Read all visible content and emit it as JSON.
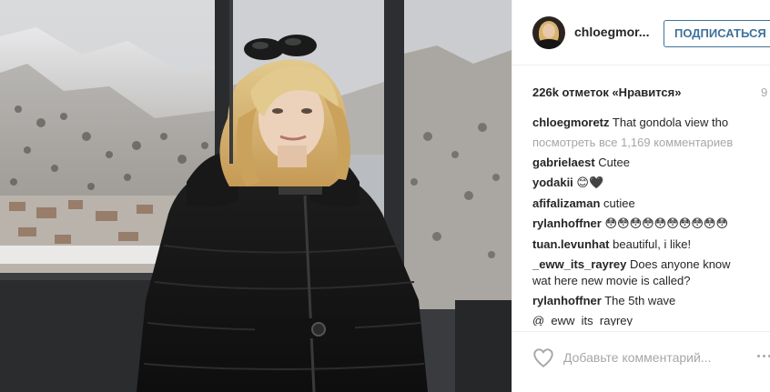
{
  "post": {
    "image_alt": "Photo in gondola with snowy mountains",
    "username": "chloegmor...",
    "follow_label": "ПОДПИСАТЬСЯ",
    "likes": "226k отметок «Нравится»",
    "age": "9",
    "comments": [
      {
        "author": "chloegmoretz",
        "text": "That gondola view tho"
      },
      {
        "author": "",
        "text": "посмотреть все 1,169 комментариев",
        "view_all": true
      },
      {
        "author": "gabrielaest",
        "text": "Cutee"
      },
      {
        "author": "yodakii",
        "text": "😊🖤"
      },
      {
        "author": "afifalizaman",
        "text": "cutiee"
      },
      {
        "author": "rylanhoffner",
        "text": "😳😳😳😳😳😳😳😳😳😳"
      },
      {
        "author": "tuan.levunhat",
        "text": "beautiful, i like!"
      },
      {
        "author": "_eww_its_rayrey",
        "text": "Does anyone know wat here new movie is called?"
      },
      {
        "author": "rylanhoffner",
        "text": "The 5th wave"
      },
      {
        "author": "",
        "text": "@_eww_its_rayrey"
      }
    ],
    "add_comment_placeholder": "Добавьте комментарий...",
    "icons": {
      "like": "heart-outline-icon",
      "options": "more-options-icon"
    }
  },
  "colors": {
    "link_blue": "#3f729b",
    "muted": "#a5a7aa",
    "text": "#262626",
    "border": "#efefef"
  }
}
